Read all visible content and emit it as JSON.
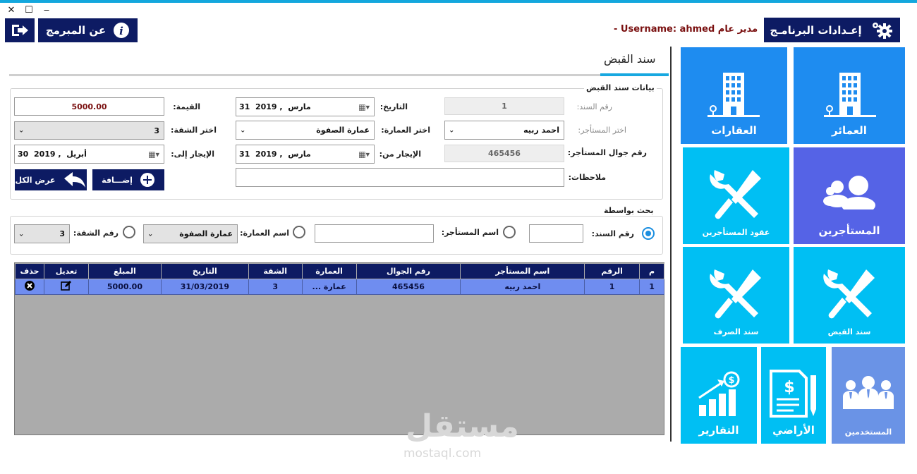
{
  "window": {
    "close": "✕",
    "maximize": "☐",
    "minimize": "‒"
  },
  "header": {
    "about_label": "عن المبرمج",
    "settings_label": "إعـدادات البرنامـج",
    "user_role": "مدير عام",
    "user_text": "- Username: ahmed"
  },
  "page": {
    "title": "سند القبض"
  },
  "form": {
    "group_title": "بيانات سند القبض",
    "voucher_no_label": "رقم السند:",
    "voucher_no_value": "1",
    "date_label": "التاريخ:",
    "date_value": "31  مارس  , 2019",
    "value_label": "القيمة:",
    "value_value": "5000.00",
    "tenant_label": "اختر المستأجر:",
    "tenant_value": "احمد ربيه",
    "building_label": "اختر العمارة:",
    "building_value": "عمارة الصفوة",
    "apartment_label": "اختر الشقة:",
    "apartment_value": "3",
    "phone_label": "رقم جوال المستأجر:",
    "phone_value": "465456",
    "rent_from_label": "الإيجار من:",
    "rent_from_value": "31  مارس  , 2019",
    "rent_to_label": "الإيجار إلى:",
    "rent_to_value": "30  أبريل  , 2019",
    "notes_label": "ملاحظات:",
    "notes_value": "",
    "add_button": "إضـــافة",
    "show_all_button": "عرض الكل"
  },
  "search": {
    "group_title": "بحث بواسطة",
    "by_voucher_label": "رقم السند:",
    "by_voucher_value": "",
    "by_tenant_label": "اسم المستأجر:",
    "by_tenant_value": "",
    "by_building_label": "اسم العمارة:",
    "by_building_value": "عمارة الصفوة",
    "by_apartment_label": "رقم الشقة:",
    "by_apartment_value": "3"
  },
  "table": {
    "headers": [
      "م",
      "الرقم",
      "اسم المستأجر",
      "رقم الجوال",
      "العمارة",
      "الشقة",
      "التاريخ",
      "المبلغ",
      "تعديل",
      "حذف"
    ],
    "rows": [
      [
        "1",
        "1",
        "احمد ربيه",
        "465456",
        "عمارة ...",
        "3",
        "31/03/2019",
        "5000.00",
        "",
        ""
      ]
    ]
  },
  "tiles": {
    "buildings": "العمائر",
    "properties": "العقارات",
    "tenants": "المستأجرين",
    "tenant_contracts": "عقود المستأجرين",
    "receipt_voucher": "سند القبض",
    "payment_voucher": "سند الصرف",
    "users": "المستخدمين",
    "lands": "الأراضي",
    "reports": "التقارير"
  },
  "watermark": {
    "arabic": "مستقل",
    "latin": "mostaql.com"
  },
  "colors": {
    "navy": "#0d1b63",
    "cyan": "#13a7dd",
    "tile_blue": "#1e8cf0",
    "tile_cyan": "#00bff3",
    "tile_purple": "#5563e6",
    "row_blue": "#6f8df0"
  }
}
